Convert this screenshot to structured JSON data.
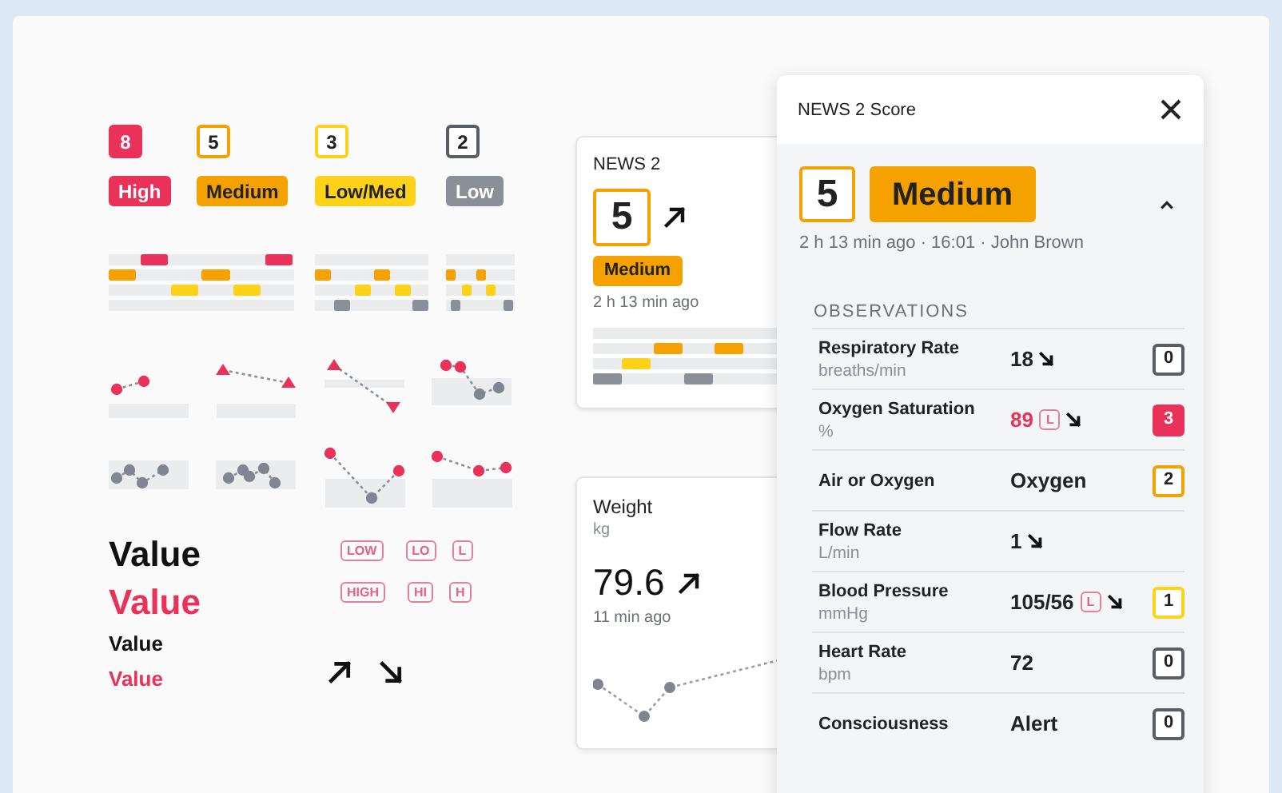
{
  "legend": [
    {
      "score": "8",
      "kind": "high",
      "label": "High"
    },
    {
      "score": "5",
      "kind": "medium",
      "label": "Medium"
    },
    {
      "score": "3",
      "kind": "low_medium",
      "label": "Low/Med"
    },
    {
      "score": "2",
      "kind": "low",
      "label": "Low"
    }
  ],
  "value_styles": [
    {
      "text": "Value",
      "kind": "large",
      "alert": false
    },
    {
      "text": "Value",
      "kind": "large",
      "alert": true
    },
    {
      "text": "Value",
      "kind": "small",
      "alert": false
    },
    {
      "text": "Value",
      "kind": "small",
      "alert": true
    }
  ],
  "range_flags": [
    {
      "tags": [
        "LOW",
        "LO",
        "L"
      ]
    },
    {
      "tags": [
        "HIGH",
        "HI",
        "H"
      ]
    }
  ],
  "trend_arrows": [
    {
      "kind": "up"
    },
    {
      "kind": "down"
    }
  ],
  "news_card": {
    "title": "NEWS 2",
    "score": "5",
    "kind": "medium",
    "rising": true,
    "label": "Medium",
    "time": "2 h 13 min ago"
  },
  "weight_card": {
    "title": "Weight",
    "unit": "kg",
    "value": "79.6",
    "rising": true,
    "time": "11 min ago"
  },
  "score_panel": {
    "title": "NEWS 2 Score",
    "score": "5",
    "kind": "medium",
    "label": "Medium",
    "meta": "2 h 13 min ago · 16:01 · John Brown",
    "expanded": true,
    "section": "OBSERVATIONS",
    "observations": [
      {
        "name": "Respiratory Rate",
        "unit": "breaths/min",
        "value": "18",
        "alert": false,
        "falling": true,
        "score": "0",
        "kind": "low"
      },
      {
        "name": "Oxygen Saturation",
        "unit": "%",
        "value": "89",
        "alert": true,
        "flag": "L",
        "falling": true,
        "score": "3",
        "kind": "high"
      },
      {
        "name": "Air or Oxygen",
        "value": "Oxygen",
        "alert": false,
        "score": "2",
        "kind": "medium"
      },
      {
        "name": "Flow Rate",
        "unit": "L/min",
        "value": "1",
        "alert": false,
        "falling": true
      },
      {
        "name": "Blood Pressure",
        "unit": "mmHg",
        "value": "105/56",
        "alert": false,
        "flag": "L",
        "falling": true,
        "score": "1",
        "kind": "low_medium"
      },
      {
        "name": "Heart Rate",
        "unit": "bpm",
        "value": "72",
        "alert": false,
        "score": "0",
        "kind": "low"
      },
      {
        "name": "Consciousness",
        "value": "Alert",
        "alert": false,
        "score": "0",
        "kind": "low"
      }
    ]
  }
}
